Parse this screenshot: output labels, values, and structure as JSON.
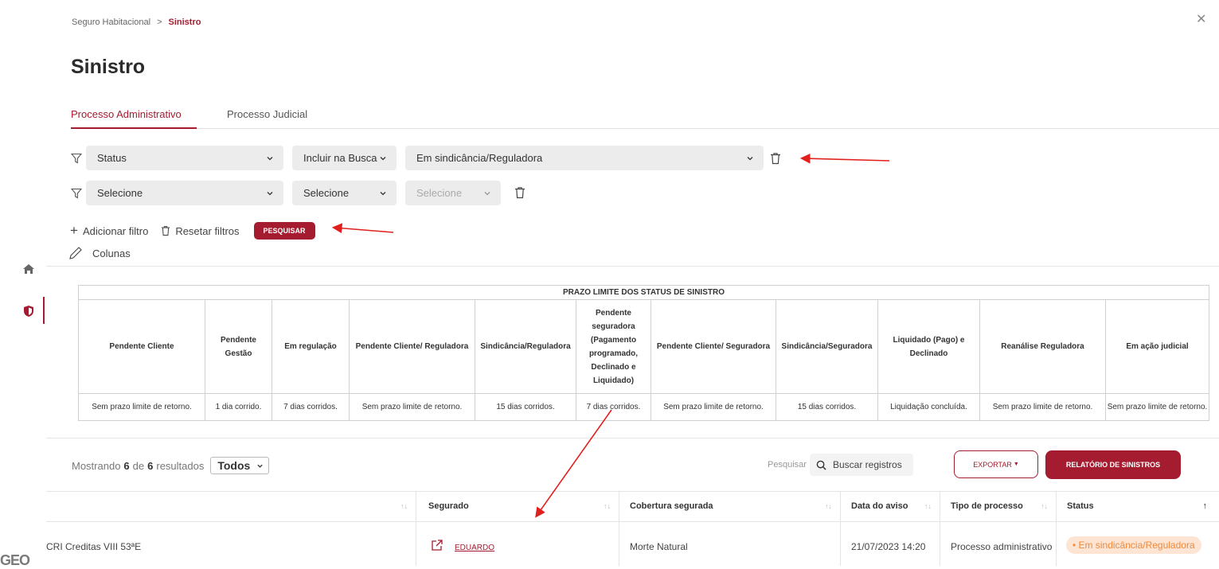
{
  "header": {
    "breadcrumb": [
      "Seguro Habitacional",
      ">",
      "Sinistro"
    ],
    "title": "Sinistro",
    "close_icon": "close-icon"
  },
  "sidebar": {
    "items": [
      {
        "icon": "home-icon"
      },
      {
        "icon": "shield-icon",
        "active": true
      }
    ],
    "logo": "GEO"
  },
  "tabs": [
    {
      "label": "Processo Administrativo",
      "active": true
    },
    {
      "label": "Processo Judicial",
      "active": false
    }
  ],
  "filters": [
    {
      "field": "Status",
      "operator": "Incluir na Busca",
      "value": "Em sindicância/Reguladora"
    },
    {
      "field": "Selecione",
      "operator": "Selecione",
      "value": "Selecione"
    }
  ],
  "actions": {
    "add_filter": "Adicionar filtro",
    "reset_filters": "Resetar filtros",
    "search": "PESQUISAR",
    "columns": "Colunas"
  },
  "prazo_table": {
    "title": "PRAZO LIMITE DOS STATUS DE SINISTRO",
    "columns": [
      {
        "header": "Pendente Cliente",
        "value": "Sem prazo limite de retorno."
      },
      {
        "header": "Pendente Gestão",
        "value": "1 dia corrido."
      },
      {
        "header": "Em regulação",
        "value": "7 dias corridos."
      },
      {
        "header": "Pendente Cliente/ Reguladora",
        "value": "Sem prazo limite de retorno."
      },
      {
        "header": "Sindicância/Reguladora",
        "value": "15 dias corridos."
      },
      {
        "header": "Pendente seguradora (Pagamento programado, Declinado e Liquidado)",
        "value": "7 dias corridos."
      },
      {
        "header": "Pendente Cliente/ Seguradora",
        "value": "Sem prazo limite de retorno."
      },
      {
        "header": "Sindicância/Seguradora",
        "value": "15 dias corridos."
      },
      {
        "header": "Liquidado (Pago) e Declinado",
        "value": "Liquidação concluída."
      },
      {
        "header": "Reanálise Reguladora",
        "value": "Sem prazo limite de retorno."
      },
      {
        "header": "Em ação judicial",
        "value": "Sem prazo limite de retorno."
      }
    ]
  },
  "results": {
    "showing_prefix": "Mostrando",
    "shown": "6",
    "of": "de",
    "total": "6",
    "suffix": "resultados",
    "page_size": "Todos",
    "search_label": "Pesquisar",
    "search_placeholder": "Buscar registros",
    "export_label": "EXPORTAR",
    "report_label": "RELATÓRIO DE SINISTROS",
    "columns": [
      "Segurado",
      "Cobertura segurada",
      "Data do aviso",
      "Tipo de processo",
      "Status"
    ],
    "rows": [
      {
        "operacao": "CRI Creditas VIII 53ªE",
        "segurado": "EDUARDO",
        "cobertura": "Morte Natural",
        "data_aviso": "21/07/2023 14:20",
        "tipo": "Processo administrativo",
        "status": "• Em sindicância/Reguladora"
      }
    ]
  },
  "colors": {
    "brand": "#a51c30",
    "badge_bg": "#fde4d3",
    "badge_text": "#ef8a3c",
    "annotation": "#e0201c"
  }
}
